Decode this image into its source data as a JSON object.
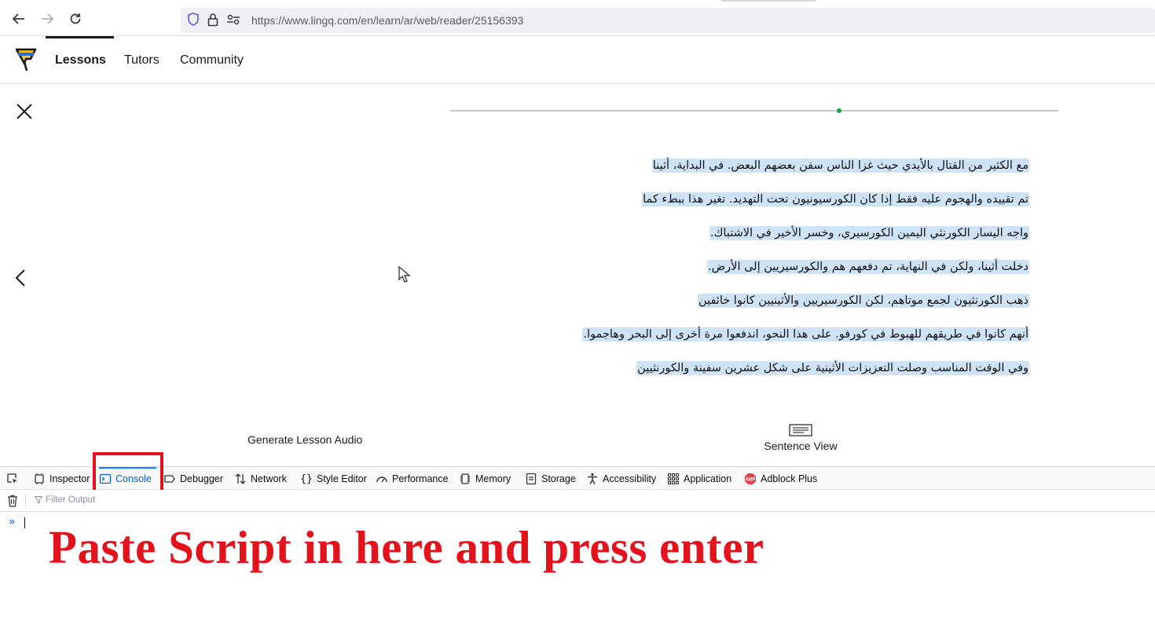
{
  "browser": {
    "url_prefix": "https://www.",
    "url_host": "lingq.com",
    "url_path": "/en/learn/ar/web/reader/25156393"
  },
  "site": {
    "nav": [
      {
        "label": "Lessons",
        "active": true
      },
      {
        "label": "Tutors",
        "active": false
      },
      {
        "label": "Community",
        "active": false
      }
    ],
    "accent_color": "#19a33b"
  },
  "reader": {
    "progress_fraction": 0.64,
    "lines": [
      "مع الكثير من القتال بالأيدي حيث غزا الناس سفن بعضهم البعض.  في البداية، أثينا",
      "تم تقييده والهجوم عليه فقط إذا كان الكورسيونيون تحت التهديد.  تغير هذا ببطء كما",
      "واجه اليسار الكورنثي اليمين الكورسيري، وخسر الأخير في الاشتباك.",
      "دخلت أثينا، ولكن في النهاية، تم دفعهم هم والكورسيريين إلى الأرض.",
      "ذهب الكورنثيون لجمع موتاهم، لكن الكورسيريين والأثينيين كانوا خائفين",
      "أنهم كانوا في طريقهم للهبوط في كورفو.  على هذا النحو، اندفعوا مرة أخرى إلى البحر وهاجموا.",
      "وفي الوقت المناسب وصلت التعزيزات الأثينية على شكل عشرين سفينة والكورنثيين"
    ],
    "generate_audio_label": "Generate Lesson Audio",
    "sentence_view_label": "Sentence View"
  },
  "devtools": {
    "tabs": [
      {
        "label": "Inspector",
        "icon": "inspector-icon"
      },
      {
        "label": "Console",
        "icon": "console-icon",
        "active": true
      },
      {
        "label": "Debugger",
        "icon": "debugger-icon"
      },
      {
        "label": "Network",
        "icon": "network-icon"
      },
      {
        "label": "Style Editor",
        "icon": "style-editor-icon"
      },
      {
        "label": "Performance",
        "icon": "performance-icon"
      },
      {
        "label": "Memory",
        "icon": "memory-icon"
      },
      {
        "label": "Storage",
        "icon": "storage-icon"
      },
      {
        "label": "Accessibility",
        "icon": "accessibility-icon"
      },
      {
        "label": "Application",
        "icon": "application-icon"
      },
      {
        "label": "Adblock Plus",
        "icon": "adblock-plus-icon"
      }
    ],
    "filter_placeholder": "Filter Output",
    "prompt": "»",
    "highlight_color": "#e3131e"
  },
  "annotation": {
    "text": "Paste Script in here and press enter"
  }
}
